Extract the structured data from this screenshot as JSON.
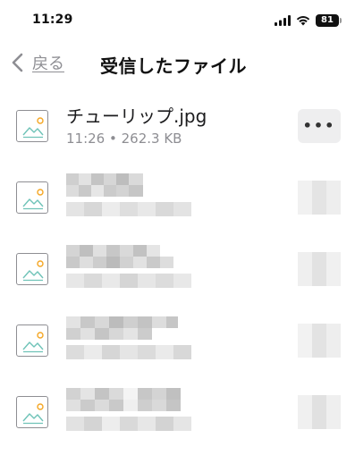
{
  "status_bar": {
    "time": "11:29",
    "battery": "81",
    "icons": [
      "cellular-signal-icon",
      "wifi-icon",
      "battery-icon"
    ]
  },
  "nav": {
    "back_label": "戻る",
    "title": "受信したファイル"
  },
  "files": [
    {
      "name": "チューリップ.jpg",
      "meta": "11:26 • 262.3 KB",
      "icon": "image-file-icon",
      "more_label": "•••",
      "redacted": false
    },
    {
      "name": "",
      "meta": "",
      "icon": "image-file-icon",
      "redacted": true
    },
    {
      "name": "",
      "meta": "",
      "icon": "image-file-icon",
      "redacted": true
    },
    {
      "name": "",
      "meta": "",
      "icon": "image-file-icon",
      "redacted": true
    },
    {
      "name": "",
      "meta": "",
      "icon": "image-file-icon",
      "redacted": true
    }
  ],
  "colors": {
    "accent_sun": "#f5a623",
    "mountain": "#6fc3b8",
    "secondary_text": "#8e8e93",
    "more_button_bg": "#eeeeef"
  }
}
